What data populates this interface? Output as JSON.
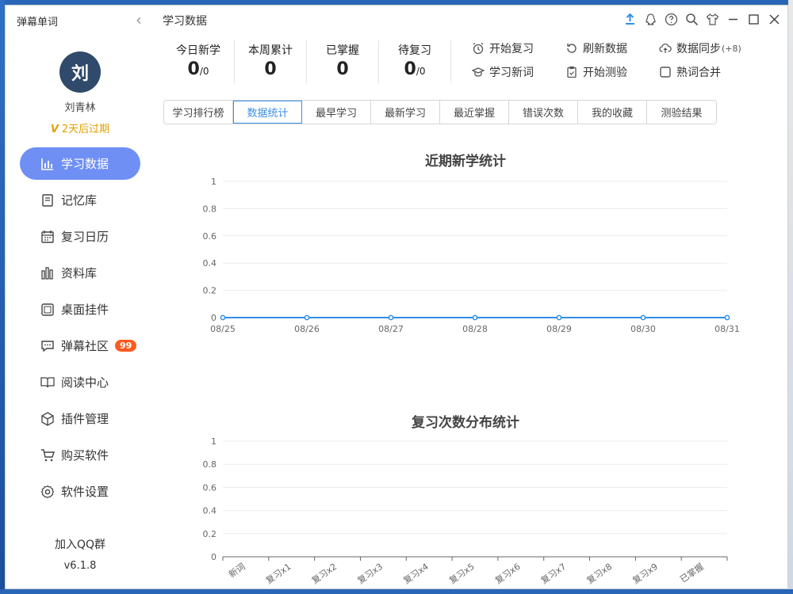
{
  "app": {
    "title": "弹幕单词"
  },
  "user": {
    "avatar_char": "刘",
    "name": "刘青林",
    "expire": "2天后过期"
  },
  "nav": [
    {
      "label": "学习数据",
      "icon": "bar-chart-icon",
      "active": true
    },
    {
      "label": "记忆库",
      "icon": "memory-book-icon"
    },
    {
      "label": "复习日历",
      "icon": "calendar-icon"
    },
    {
      "label": "资料库",
      "icon": "library-icon"
    },
    {
      "label": "桌面挂件",
      "icon": "widget-icon"
    },
    {
      "label": "弹幕社区",
      "icon": "chat-bubble-icon",
      "badge": "99"
    },
    {
      "label": "阅读中心",
      "icon": "open-book-icon"
    },
    {
      "label": "插件管理",
      "icon": "cube-icon"
    },
    {
      "label": "购买软件",
      "icon": "cart-icon"
    },
    {
      "label": "软件设置",
      "icon": "gear-icon"
    }
  ],
  "footer": {
    "qq_group": "加入QQ群",
    "version": "v6.1.8"
  },
  "header": {
    "title": "学习数据"
  },
  "stats": [
    {
      "label": "今日新学",
      "value": "0",
      "denom": "/0"
    },
    {
      "label": "本周累计",
      "value": "0",
      "denom": ""
    },
    {
      "label": "已掌握",
      "value": "0",
      "denom": ""
    },
    {
      "label": "待复习",
      "value": "0",
      "denom": "/0"
    }
  ],
  "actions": {
    "start_review": "开始复习",
    "refresh_data": "刷新数据",
    "data_sync": "数据同步",
    "data_sync_count": "(+8)",
    "learn_new": "学习新词",
    "start_test": "开始测验",
    "merge_familiar": "熟词合并"
  },
  "tabs": [
    "学习排行榜",
    "数据统计",
    "最早学习",
    "最新学习",
    "最近掌握",
    "错误次数",
    "我的收藏",
    "测验结果"
  ],
  "active_tab": 1,
  "colors": {
    "accent": "#6f8ff5",
    "line": "#2f8fe8",
    "badge": "#ff5a1f",
    "expire": "#e0a000"
  },
  "chart_data": [
    {
      "type": "line",
      "title": "近期新学统计",
      "categories": [
        "08/25",
        "08/26",
        "08/27",
        "08/28",
        "08/29",
        "08/30",
        "08/31"
      ],
      "series": [
        {
          "values": [
            0,
            0,
            0,
            0,
            0,
            0,
            0
          ]
        }
      ],
      "y_ticks": [
        "0",
        "0.2",
        "0.4",
        "0.6",
        "0.8",
        "1"
      ],
      "ylim": [
        0,
        1
      ],
      "grid": true
    },
    {
      "type": "bar",
      "title": "复习次数分布统计",
      "categories": [
        "新词",
        "复习x1",
        "复习x2",
        "复习x3",
        "复习x4",
        "复习x5",
        "复习x6",
        "复习x7",
        "复习x8",
        "复习x9",
        "已掌握"
      ],
      "series": [
        {
          "values": [
            0,
            0,
            0,
            0,
            0,
            0,
            0,
            0,
            0,
            0,
            0
          ]
        }
      ],
      "y_ticks": [
        "0",
        "0.2",
        "0.4",
        "0.6",
        "0.8",
        "1"
      ],
      "ylim": [
        0,
        1
      ],
      "grid": true
    }
  ]
}
